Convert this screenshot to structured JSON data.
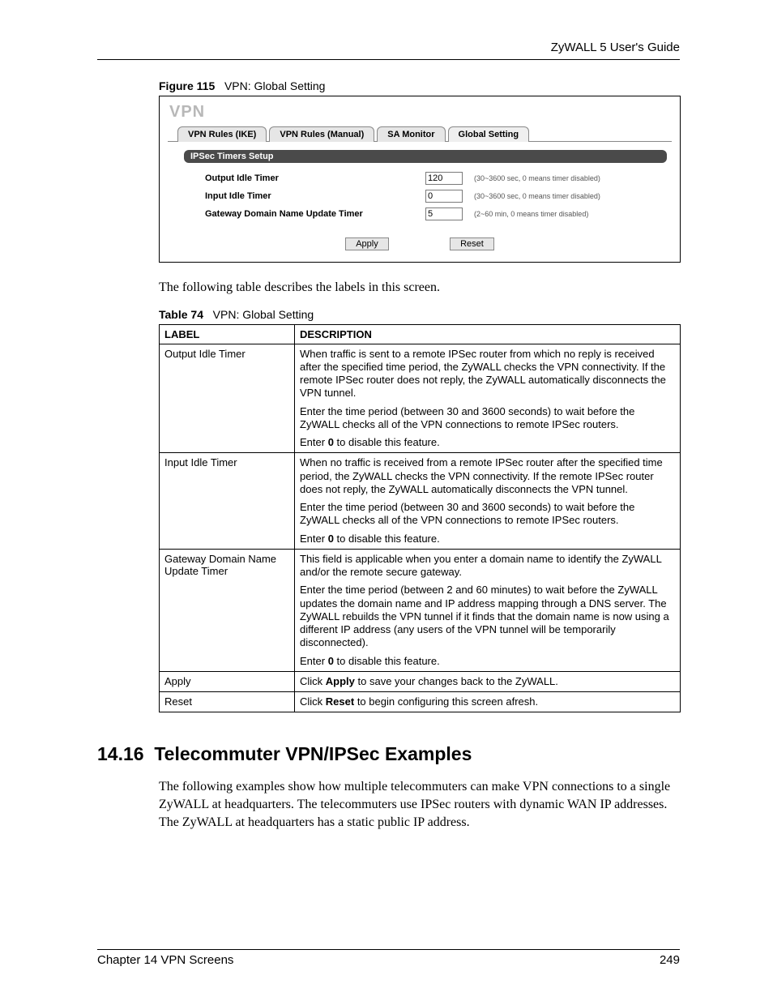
{
  "header": {
    "guide": "ZyWALL 5 User's Guide"
  },
  "figure": {
    "label": "Figure 115",
    "title": "VPN: Global Setting"
  },
  "screenshot": {
    "title": "VPN",
    "tabs": [
      "VPN Rules (IKE)",
      "VPN Rules (Manual)",
      "SA Monitor",
      "Global Setting"
    ],
    "section_bar": "IPSec Timers Setup",
    "rows": [
      {
        "label": "Output Idle Timer",
        "value": "120",
        "hint": "(30~3600 sec, 0 means timer disabled)"
      },
      {
        "label": "Input Idle Timer",
        "value": "0",
        "hint": "(30~3600 sec, 0 means timer disabled)"
      },
      {
        "label": "Gateway Domain Name Update Timer",
        "value": "5",
        "hint": "(2~60 min, 0 means timer disabled)"
      }
    ],
    "buttons": {
      "apply": "Apply",
      "reset": "Reset"
    }
  },
  "intro_text": "The following table describes the labels in this screen.",
  "table_caption": {
    "label": "Table 74",
    "title": "VPN: Global Setting"
  },
  "table": {
    "head": {
      "c1": "LABEL",
      "c2": "DESCRIPTION"
    },
    "rows": [
      {
        "label": "Output Idle Timer",
        "desc": [
          "When traffic is sent to a remote IPSec router from which no reply is received after the specified time period, the ZyWALL checks the VPN connectivity. If the remote IPSec router does not reply, the ZyWALL automatically disconnects the VPN tunnel.",
          "Enter the time period (between 30 and 3600 seconds) to wait before the ZyWALL checks all of the VPN connections to remote IPSec routers.",
          "Enter 0 to disable this feature."
        ]
      },
      {
        "label": "Input Idle Timer",
        "desc": [
          "When no traffic is received from a remote IPSec router after the specified time period, the ZyWALL checks the VPN connectivity. If the remote IPSec router does not reply, the ZyWALL automatically disconnects the VPN tunnel.",
          "Enter the time period (between 30 and 3600 seconds) to wait before the ZyWALL checks all of the VPN connections to remote IPSec routers.",
          "Enter 0 to disable this feature."
        ]
      },
      {
        "label": "Gateway Domain Name Update Timer",
        "desc": [
          "This field is applicable when you enter a domain name to identify the ZyWALL and/or the remote secure gateway.",
          "Enter the time period (between 2 and 60 minutes) to wait before the ZyWALL updates the domain name and IP address mapping through a DNS server. The ZyWALL rebuilds the VPN tunnel if it finds that the domain name is now using a different IP address (any users of the VPN tunnel will be temporarily disconnected).",
          "Enter 0 to disable this feature."
        ]
      },
      {
        "label": "Apply",
        "desc": [
          "Click Apply to save your changes back to the ZyWALL."
        ]
      },
      {
        "label": "Reset",
        "desc": [
          "Click Reset to begin configuring this screen afresh."
        ]
      }
    ]
  },
  "section": {
    "number": "14.16",
    "title": "Telecommuter VPN/IPSec Examples",
    "body": "The following examples show how multiple telecommuters can make VPN connections to a single ZyWALL at headquarters. The telecommuters use IPSec routers with dynamic WAN IP addresses. The ZyWALL at headquarters has a static public IP address."
  },
  "footer": {
    "left": "Chapter 14 VPN Screens",
    "right": "249"
  }
}
